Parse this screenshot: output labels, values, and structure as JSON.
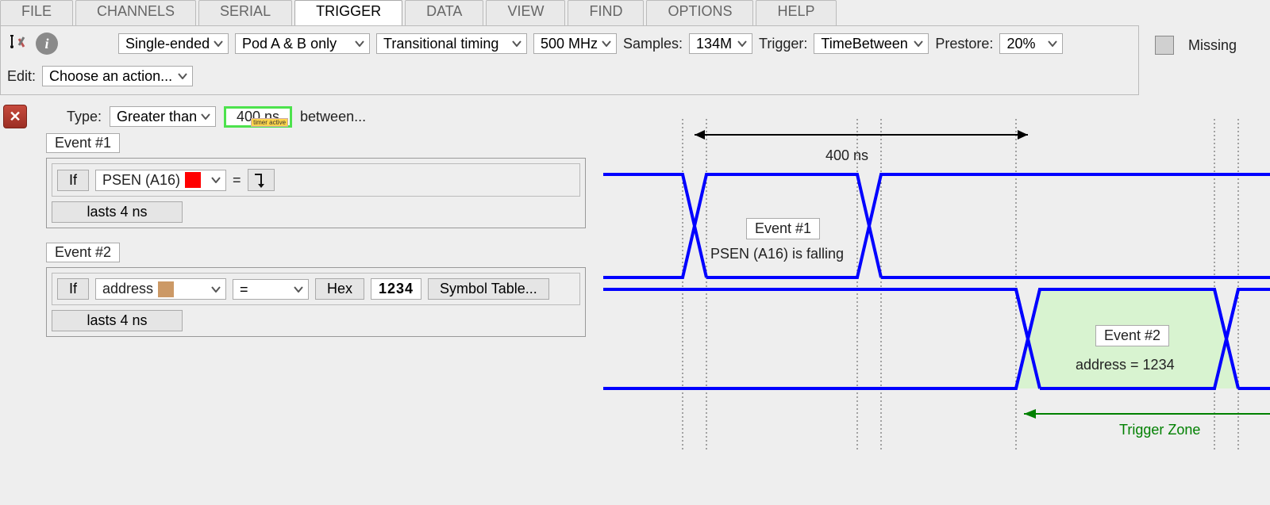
{
  "tabs": [
    "FILE",
    "CHANNELS",
    "SERIAL",
    "TRIGGER",
    "DATA",
    "VIEW",
    "FIND",
    "OPTIONS",
    "HELP"
  ],
  "active_tab": "TRIGGER",
  "toolbar": {
    "mode": "Single-ended",
    "pod": "Pod A & B only",
    "timing": "Transitional timing",
    "rate": "500 MHz",
    "samples_label": "Samples:",
    "samples": "134M",
    "trigger_label": "Trigger:",
    "trigger": "TimeBetween",
    "prestore_label": "Prestore:",
    "prestore": "20%",
    "missing": "Missing",
    "edit_label": "Edit:",
    "edit_action": "Choose an action..."
  },
  "type_row": {
    "type_label": "Type:",
    "comparator": "Greater than",
    "time_value": "400 ns",
    "timer_badge": "timer active",
    "between": "between..."
  },
  "event1": {
    "title": "Event #1",
    "if": "If",
    "signal": "PSEN (A16)",
    "eq": "=",
    "lasts": "lasts 4 ns"
  },
  "event2": {
    "title": "Event #2",
    "if": "If",
    "signal": "address",
    "cmp": "=",
    "radix": "Hex",
    "value": "1234",
    "symbol": "Symbol Table...",
    "lasts": "lasts 4 ns"
  },
  "diagram": {
    "span_label": "400 ns",
    "e1_title": "Event #1",
    "e1_desc": "PSEN (A16) is falling",
    "e2_title": "Event #2",
    "e2_desc": "address = 1234",
    "trigger_zone": "Trigger Zone"
  }
}
